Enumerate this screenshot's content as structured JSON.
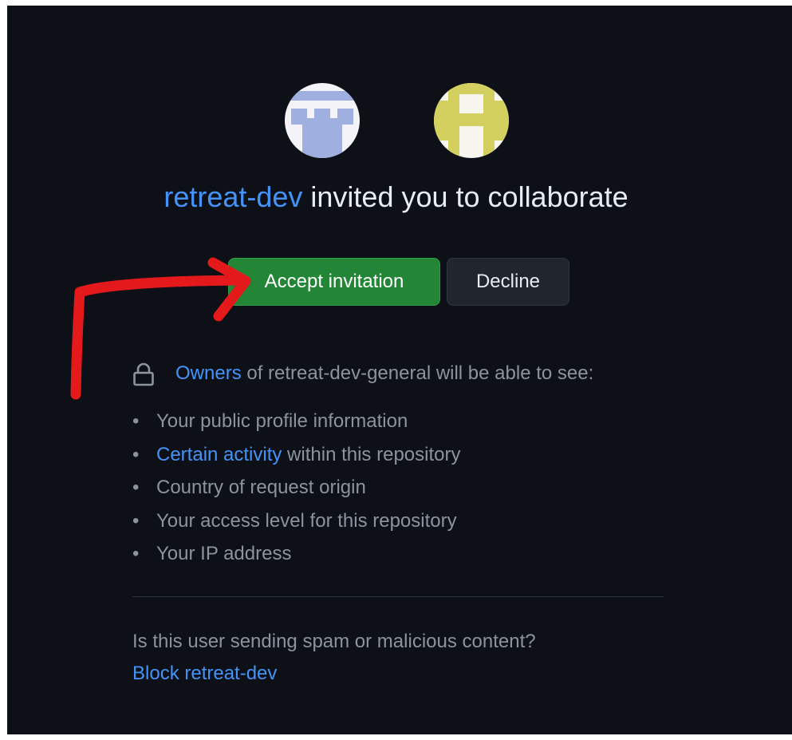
{
  "invitation": {
    "inviter": "retreat-dev",
    "headline_rest": " invited you to collaborate"
  },
  "actions": {
    "accept_label": "Accept invitation",
    "decline_label": "Decline"
  },
  "visibility": {
    "owners_link": "Owners",
    "intro_rest": " of retreat-dev-general will be able to see:",
    "bullet": "•",
    "items": [
      {
        "text": "Your public profile information"
      },
      {
        "link": "Certain activity",
        "text": " within this repository"
      },
      {
        "text": "Country of request origin"
      },
      {
        "text": "Your access level for this repository"
      },
      {
        "text": "Your IP address"
      }
    ]
  },
  "spam": {
    "question": "Is this user sending spam or malicious content?",
    "block_label": "Block retreat-dev"
  },
  "colors": {
    "page_bg": "#0d1117",
    "link": "#4493f8",
    "accept_green": "#238636",
    "annotation_arrow": "#e3191c",
    "avatar_1": "#9fb0e0",
    "avatar_2": "#d3d060"
  },
  "icons": {
    "lock": "lock-icon"
  }
}
